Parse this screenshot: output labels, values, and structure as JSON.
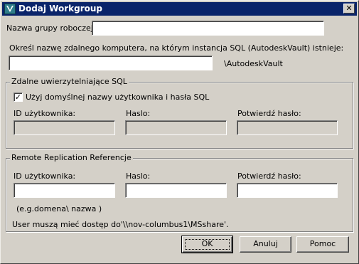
{
  "window": {
    "title": "Dodaj Workgroup",
    "close_glyph": "✕"
  },
  "group_name": {
    "label": "Nazwa grupy roboczej:",
    "value": ""
  },
  "remote_computer": {
    "label": "Określ nazwę zdalnego komputera, na którym instancja SQL (AutodeskVault) istnieje:",
    "value": "",
    "suffix": "\\AutodeskVault"
  },
  "sql_auth": {
    "legend": "Zdalne uwierzytelniające SQL",
    "checkbox_label": "Użyj domyślnej nazwy użytkownika i hasła SQL",
    "checkbox_checked": true,
    "checkbox_glyph": "✓",
    "user_id_label": "ID użytkownika:",
    "password_label": "Haslo:",
    "confirm_label": "Potwierdź hasło:"
  },
  "replication": {
    "legend": "Remote Replication Referencje",
    "user_id_label": "ID użytkownika:",
    "password_label": "Haslo:",
    "confirm_label": "Potwierdź hasło:",
    "hint": "(e.g.domena\\  nazwa    )",
    "note": "User muszą mieć dostęp do'\\\\nov-columbus1\\MSshare'."
  },
  "buttons": {
    "ok": "OK",
    "cancel": "Anuluj",
    "help": "Pomoc"
  },
  "icons": {
    "app": "vault-app-icon",
    "close": "close-icon",
    "check": "checkmark-icon"
  }
}
